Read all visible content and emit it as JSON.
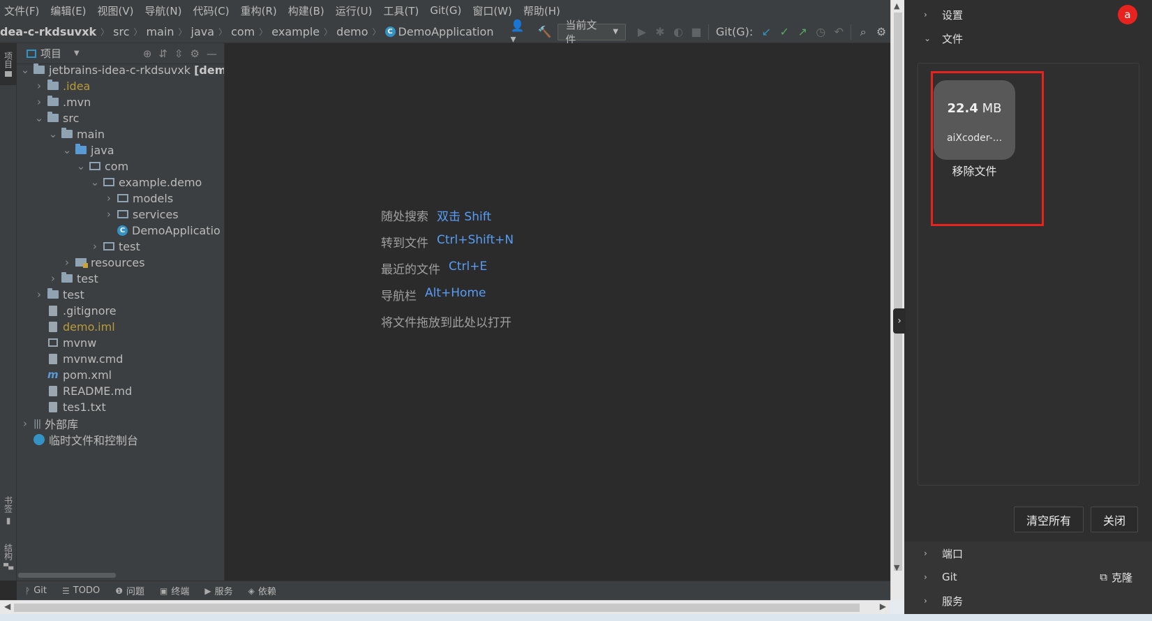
{
  "menu": [
    "文件(F)",
    "编辑(E)",
    "视图(V)",
    "导航(N)",
    "代码(C)",
    "重构(R)",
    "构建(B)",
    "运行(U)",
    "工具(T)",
    "Git(G)",
    "窗口(W)",
    "帮助(H)"
  ],
  "breadcrumb": {
    "project": "dea-c-rkdsuvxk",
    "parts": [
      "src",
      "main",
      "java",
      "com",
      "example",
      "demo"
    ],
    "class": "DemoApplication"
  },
  "toolbar": {
    "run_config": "当前文件",
    "git_label": "Git(G):"
  },
  "side_strip": {
    "project": "项目",
    "bookmarks": "书签",
    "structure": "结构"
  },
  "project_panel": {
    "title": "项目",
    "tree": [
      {
        "label": "jetbrains-idea-c-rkdsuvxk",
        "suffix": "[demo]",
        "level": 0,
        "chevron": "down",
        "icon": "module"
      },
      {
        "label": ".idea",
        "level": 1,
        "chevron": "right",
        "icon": "folder",
        "style": "yellow"
      },
      {
        "label": ".mvn",
        "level": 1,
        "chevron": "right",
        "icon": "folder"
      },
      {
        "label": "src",
        "level": 1,
        "chevron": "down",
        "icon": "folder"
      },
      {
        "label": "main",
        "level": 2,
        "chevron": "down",
        "icon": "folder"
      },
      {
        "label": "java",
        "level": 3,
        "chevron": "down",
        "icon": "folder-blue"
      },
      {
        "label": "com",
        "level": 4,
        "chevron": "down",
        "icon": "package"
      },
      {
        "label": "example.demo",
        "level": 5,
        "chevron": "down",
        "icon": "package"
      },
      {
        "label": "models",
        "level": 6,
        "chevron": "right",
        "icon": "package"
      },
      {
        "label": "services",
        "level": 6,
        "chevron": "right",
        "icon": "package"
      },
      {
        "label": "DemoApplicatio",
        "level": 6,
        "chevron": "",
        "icon": "class"
      },
      {
        "label": "test",
        "level": 5,
        "chevron": "right",
        "icon": "package"
      },
      {
        "label": "resources",
        "level": 3,
        "chevron": "right",
        "icon": "resources"
      },
      {
        "label": "test",
        "level": 2,
        "chevron": "right",
        "icon": "folder"
      },
      {
        "label": "test",
        "level": 1,
        "chevron": "right",
        "icon": "folder"
      },
      {
        "label": ".gitignore",
        "level": 1,
        "chevron": "",
        "icon": "file"
      },
      {
        "label": "demo.iml",
        "level": 1,
        "chevron": "",
        "icon": "file",
        "style": "yellow"
      },
      {
        "label": "mvnw",
        "level": 1,
        "chevron": "",
        "icon": "mvn"
      },
      {
        "label": "mvnw.cmd",
        "level": 1,
        "chevron": "",
        "icon": "file"
      },
      {
        "label": "pom.xml",
        "level": 1,
        "chevron": "",
        "icon": "maven"
      },
      {
        "label": "README.md",
        "level": 1,
        "chevron": "",
        "icon": "file"
      },
      {
        "label": "tes1.txt",
        "level": 1,
        "chevron": "",
        "icon": "file"
      },
      {
        "label": "外部库",
        "level": 0,
        "chevron": "right",
        "icon": "library"
      },
      {
        "label": "临时文件和控制台",
        "level": 0,
        "chevron": "",
        "icon": "scratch"
      }
    ]
  },
  "editor_hints": [
    {
      "label": "随处搜索",
      "key": "双击 Shift"
    },
    {
      "label": "转到文件",
      "key": "Ctrl+Shift+N"
    },
    {
      "label": "最近的文件",
      "key": "Ctrl+E"
    },
    {
      "label": "导航栏",
      "key": "Alt+Home"
    },
    {
      "label": "将文件拖放到此处以打开",
      "key": ""
    }
  ],
  "bottom_tools": [
    {
      "icon": "git-icon",
      "glyph": "ᚹ",
      "label": "Git"
    },
    {
      "icon": "todo-icon",
      "glyph": "☰",
      "label": "TODO"
    },
    {
      "icon": "problems-icon",
      "glyph": "❶",
      "label": "问题"
    },
    {
      "icon": "terminal-icon",
      "glyph": "▣",
      "label": "终端"
    },
    {
      "icon": "services-icon",
      "glyph": "▶",
      "label": "服务"
    },
    {
      "icon": "dependencies-icon",
      "glyph": "◈",
      "label": "依赖"
    }
  ],
  "right_panel": {
    "avatar": "a",
    "settings": "设置",
    "files": "文件",
    "file_card": {
      "size_value": "22.4",
      "size_unit": "MB",
      "name": "aiXcoder-...",
      "remove": "移除文件"
    },
    "clear_all": "清空所有",
    "close": "关闭",
    "ports": "端口",
    "git": "Git",
    "clone": "克隆",
    "services": "服务"
  },
  "colors": {
    "ide_bg": "#2b2b2b",
    "panel_bg": "#3c3f41",
    "right_bg": "#2f2f2f",
    "accent_blue": "#589df6",
    "highlight_red": "#e8231f",
    "yellow_text": "#b89c3a"
  }
}
